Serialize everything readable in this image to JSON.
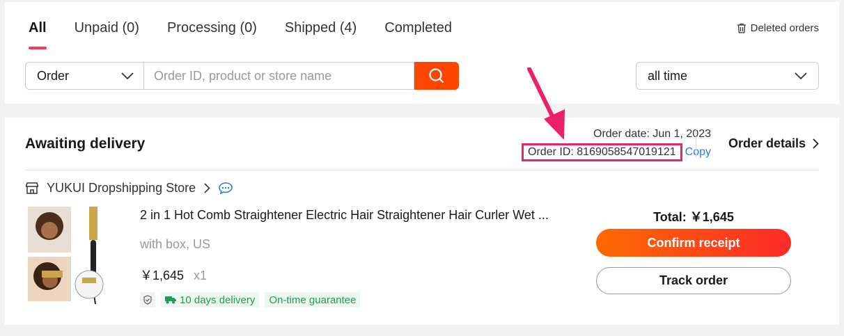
{
  "tabs": [
    {
      "label": "All",
      "active": true
    },
    {
      "label": "Unpaid (0)"
    },
    {
      "label": "Processing (0)"
    },
    {
      "label": "Shipped (4)"
    },
    {
      "label": "Completed"
    }
  ],
  "deleted_orders": "Deleted orders",
  "search": {
    "type_value": "Order",
    "placeholder": "Order ID, product or store name",
    "time_value": "all time"
  },
  "order": {
    "status": "Awaiting delivery",
    "date": "Order date: Jun 1, 2023",
    "id": "Order ID: 8169058547019121",
    "copy": "Copy",
    "details": "Order details",
    "store": "YUKUI Dropshipping Store",
    "product_name": "2 in 1 Hot Comb Straightener Electric Hair Straightener Hair Curler Wet ...",
    "variant": "with box, US",
    "price": "￥1,645",
    "qty": "x1",
    "badges": [
      "10 days delivery",
      "On-time guarantee"
    ],
    "total": "Total: ￥1,645",
    "confirm": "Confirm receipt",
    "track": "Track order"
  },
  "colors": {
    "accent": "#fd4700",
    "highlight": "#e8246f",
    "link": "#2d7be4",
    "green": "#1f9a58"
  }
}
